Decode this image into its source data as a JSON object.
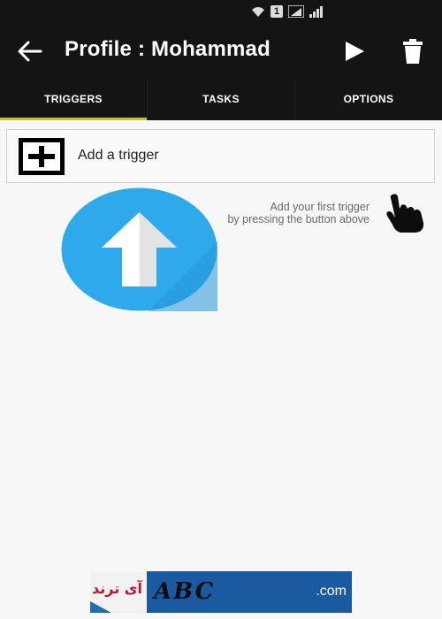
{
  "app_bar": {
    "title": "Profile : Mohammad",
    "back_icon": "arrow-left-icon",
    "play_icon": "play-icon",
    "delete_icon": "trash-icon"
  },
  "status_bar": {
    "icons": [
      "wifi-icon",
      "sim-1-icon",
      "signal-icon",
      "signal-icon"
    ],
    "sim_label": "1"
  },
  "tabs": [
    {
      "label": "TRIGGERS",
      "active": true
    },
    {
      "label": "TASKS",
      "active": false
    },
    {
      "label": "OPTIONS",
      "active": false
    }
  ],
  "add_trigger": {
    "label": "Add a trigger",
    "icon": "plus-box-icon"
  },
  "hint": {
    "line1": "Add your first trigger",
    "line2": "by pressing the button above"
  },
  "watermark": {
    "text_fa": "آی ترند",
    "text_com": ".com",
    "letters": "ABC"
  },
  "colors": {
    "bar_bg": "#141414",
    "tab_indicator": "#c8c428",
    "arrow_circle": "#2ea9ec",
    "page_bg": "#f7f7f7"
  }
}
